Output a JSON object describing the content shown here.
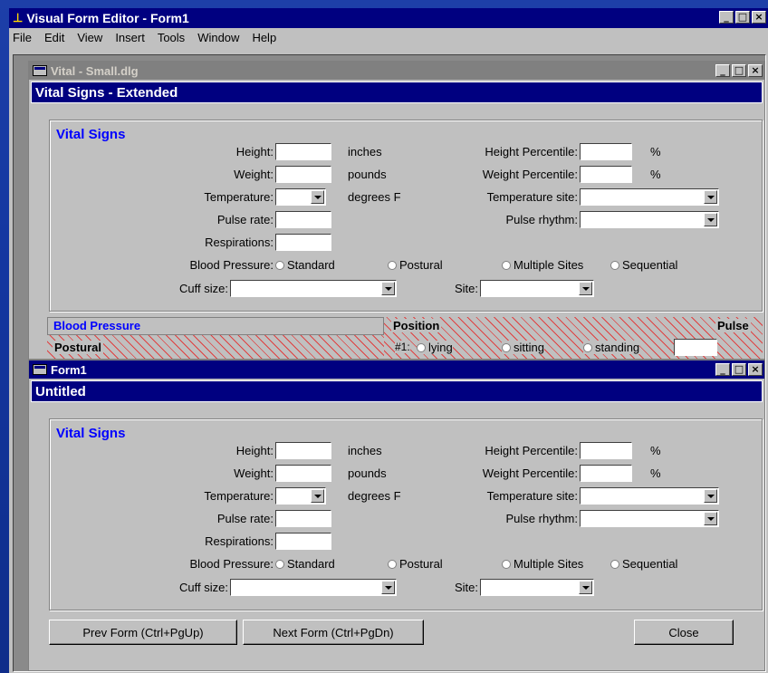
{
  "app": {
    "title": "Visual Form Editor - Form1",
    "menu": [
      "File",
      "Edit",
      "View",
      "Insert",
      "Tools",
      "Window",
      "Help"
    ]
  },
  "caption_buttons": {
    "minimize": "_",
    "maximize": "□",
    "close": "×"
  },
  "win1": {
    "title": "Vital - Small.dlg",
    "form_title": "Vital Signs - Extended",
    "group_title": "Vital Signs",
    "bp_section": {
      "label": "Blood Pressure",
      "position_label": "Position",
      "pulse_label": "Pulse",
      "postural_label": "Postural",
      "row_number": "#1:",
      "options": [
        "lying",
        "sitting",
        "standing"
      ]
    }
  },
  "win2": {
    "title": "Form1",
    "form_title": "Untitled",
    "group_title": "Vital Signs",
    "buttons": {
      "prev": "Prev Form (Ctrl+PgUp)",
      "next": "Next Form (Ctrl+PgDn)",
      "close": "Close"
    }
  },
  "vitals": {
    "height_label": "Height:",
    "height_unit": "inches",
    "height_pct_label": "Height Percentile:",
    "weight_label": "Weight:",
    "weight_unit": "pounds",
    "weight_pct_label": "Weight Percentile:",
    "pct_unit": "%",
    "temp_label": "Temperature:",
    "temp_unit": "degrees F",
    "temp_site_label": "Temperature site:",
    "pulse_rate_label": "Pulse rate:",
    "pulse_rhythm_label": "Pulse rhythm:",
    "resp_label": "Respirations:",
    "bp_label": "Blood Pressure:",
    "bp_options": [
      "Standard",
      "Postural",
      "Multiple Sites",
      "Sequential"
    ],
    "cuff_label": "Cuff size:",
    "site_label": "Site:"
  }
}
